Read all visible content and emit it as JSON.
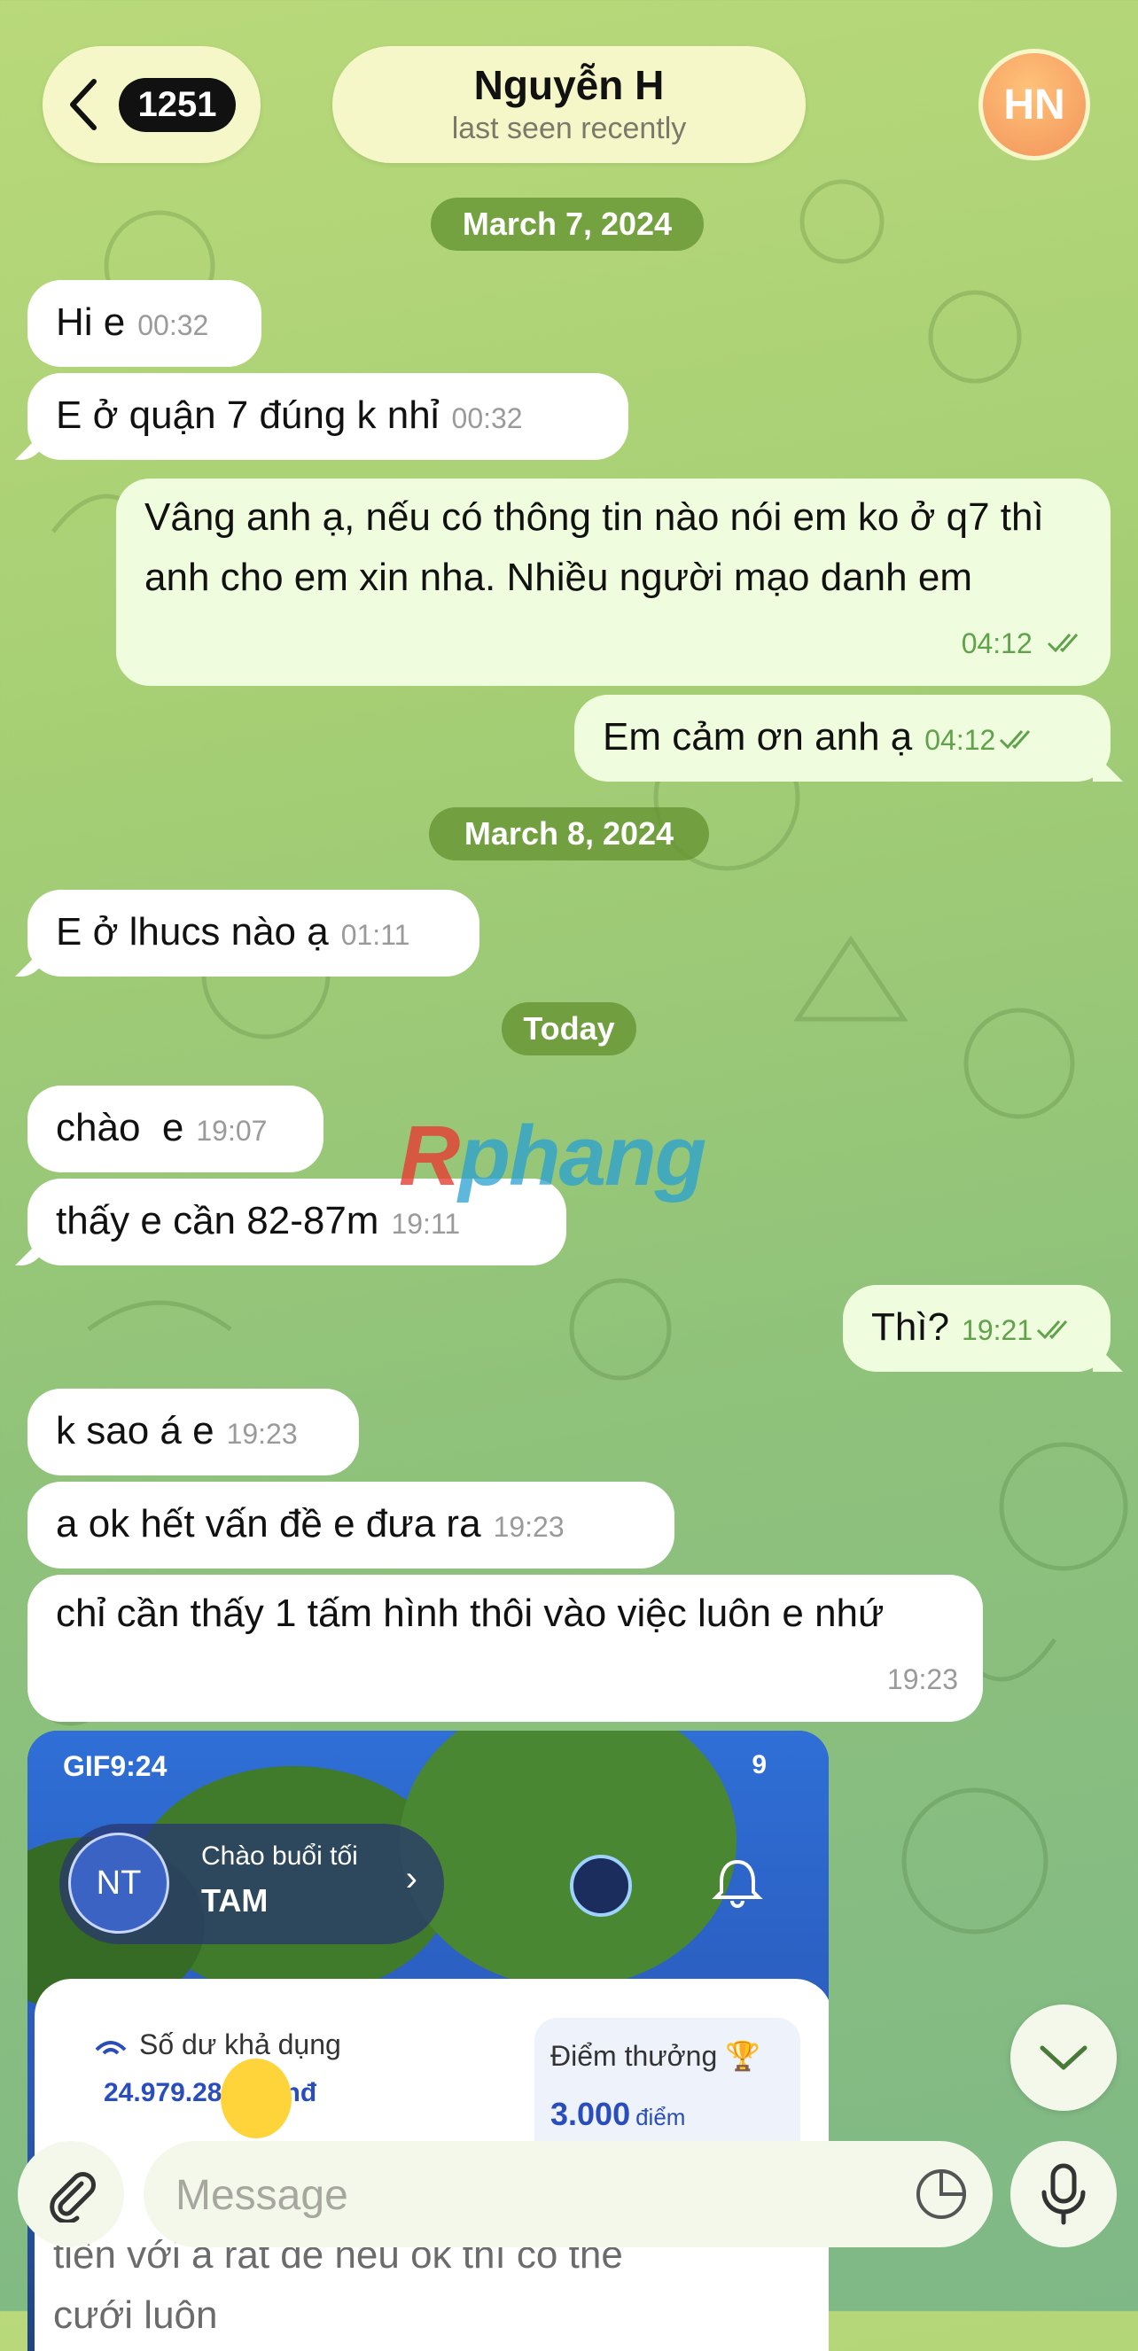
{
  "header": {
    "back_count": "1251",
    "name": "Nguyễn H",
    "status": "last seen recently",
    "avatar_initials": "HN"
  },
  "dates": {
    "d1": "March 7, 2024",
    "d2": "March 8, 2024",
    "d3": "Today"
  },
  "messages": [
    {
      "text": "Hi e",
      "time": "00:32"
    },
    {
      "text": "E ở quận 7 đúng k nhỉ",
      "time": "00:32"
    },
    {
      "text": "Vâng anh ạ, nếu có thông tin nào nói em ko ở q7 thì anh cho em xin nha. Nhiều người mạo danh em",
      "time": "04:12"
    },
    {
      "text": "Em cảm ơn anh ạ",
      "time": "04:12"
    },
    {
      "text": "E ở lhucs nào ạ",
      "time": "01:11"
    },
    {
      "text": "chào  e",
      "time": "19:07"
    },
    {
      "text": "thấy e cần 82-87m",
      "time": "19:11"
    },
    {
      "text": "Thì?",
      "time": "19:21"
    },
    {
      "text": "k sao á e",
      "time": "19:23"
    },
    {
      "text": "a ok hết vấn đề e đưa ra",
      "time": "19:23"
    },
    {
      "text": "chỉ cần thấy 1 tấm hình thôi vào việc luôn e nhứ",
      "time": "19:23"
    }
  ],
  "image_message": {
    "status_left": "GIF9:24",
    "signal": "9",
    "initials": "NT",
    "greeting": "Chào buổi tối",
    "user_name": "TAM",
    "balance_label": "Số dư khả dụng",
    "balance_value": "24.979.28  00 Vnđ",
    "points_label": "Điểm thưởng",
    "points_value": "3.000",
    "points_unit": "điểm",
    "caption_line1": "tiền với a rất dễ nếu  ok thì có thể",
    "caption_line2": "cưới luôn"
  },
  "watermark": {
    "r": "R",
    "rest": "phang"
  },
  "input": {
    "placeholder": "Message"
  },
  "colors": {
    "incoming": "#ffffff",
    "outgoing": "#effdde",
    "accent_green": "#5fa24a",
    "date_pill": "#689634"
  }
}
